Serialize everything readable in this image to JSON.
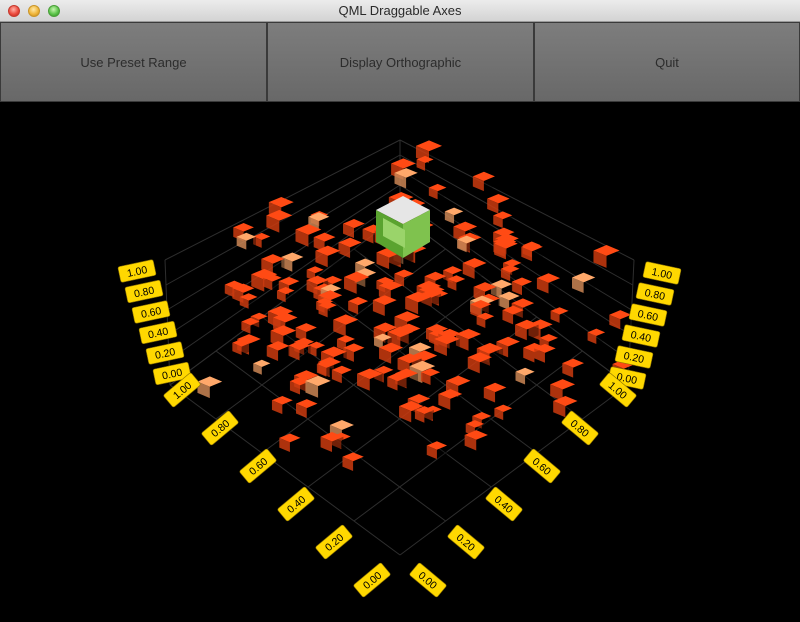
{
  "window": {
    "title": "QML Draggable Axes"
  },
  "toolbar": {
    "preset_label": "Use Preset Range",
    "ortho_label": "Display Orthographic",
    "quit_label": "Quit"
  },
  "graph": {
    "item_color": "#ff4a14",
    "highlight_color": "#ffa86a",
    "label_bg": "#ffd800",
    "selected_item_icon": "qt-logo-cube-icon",
    "left_vertical_ticks": [
      "1.00",
      "0.80",
      "0.60",
      "0.40",
      "0.20",
      "0.00"
    ],
    "right_vertical_ticks": [
      "1.00",
      "0.80",
      "0.60",
      "0.40",
      "0.20",
      "0.00"
    ],
    "left_floor_ticks": [
      "1.00",
      "0.80",
      "0.60",
      "0.40",
      "0.20",
      "0.00"
    ],
    "right_floor_ticks": [
      "1.00",
      "0.80",
      "0.60",
      "0.40",
      "0.20",
      "0.00"
    ]
  }
}
